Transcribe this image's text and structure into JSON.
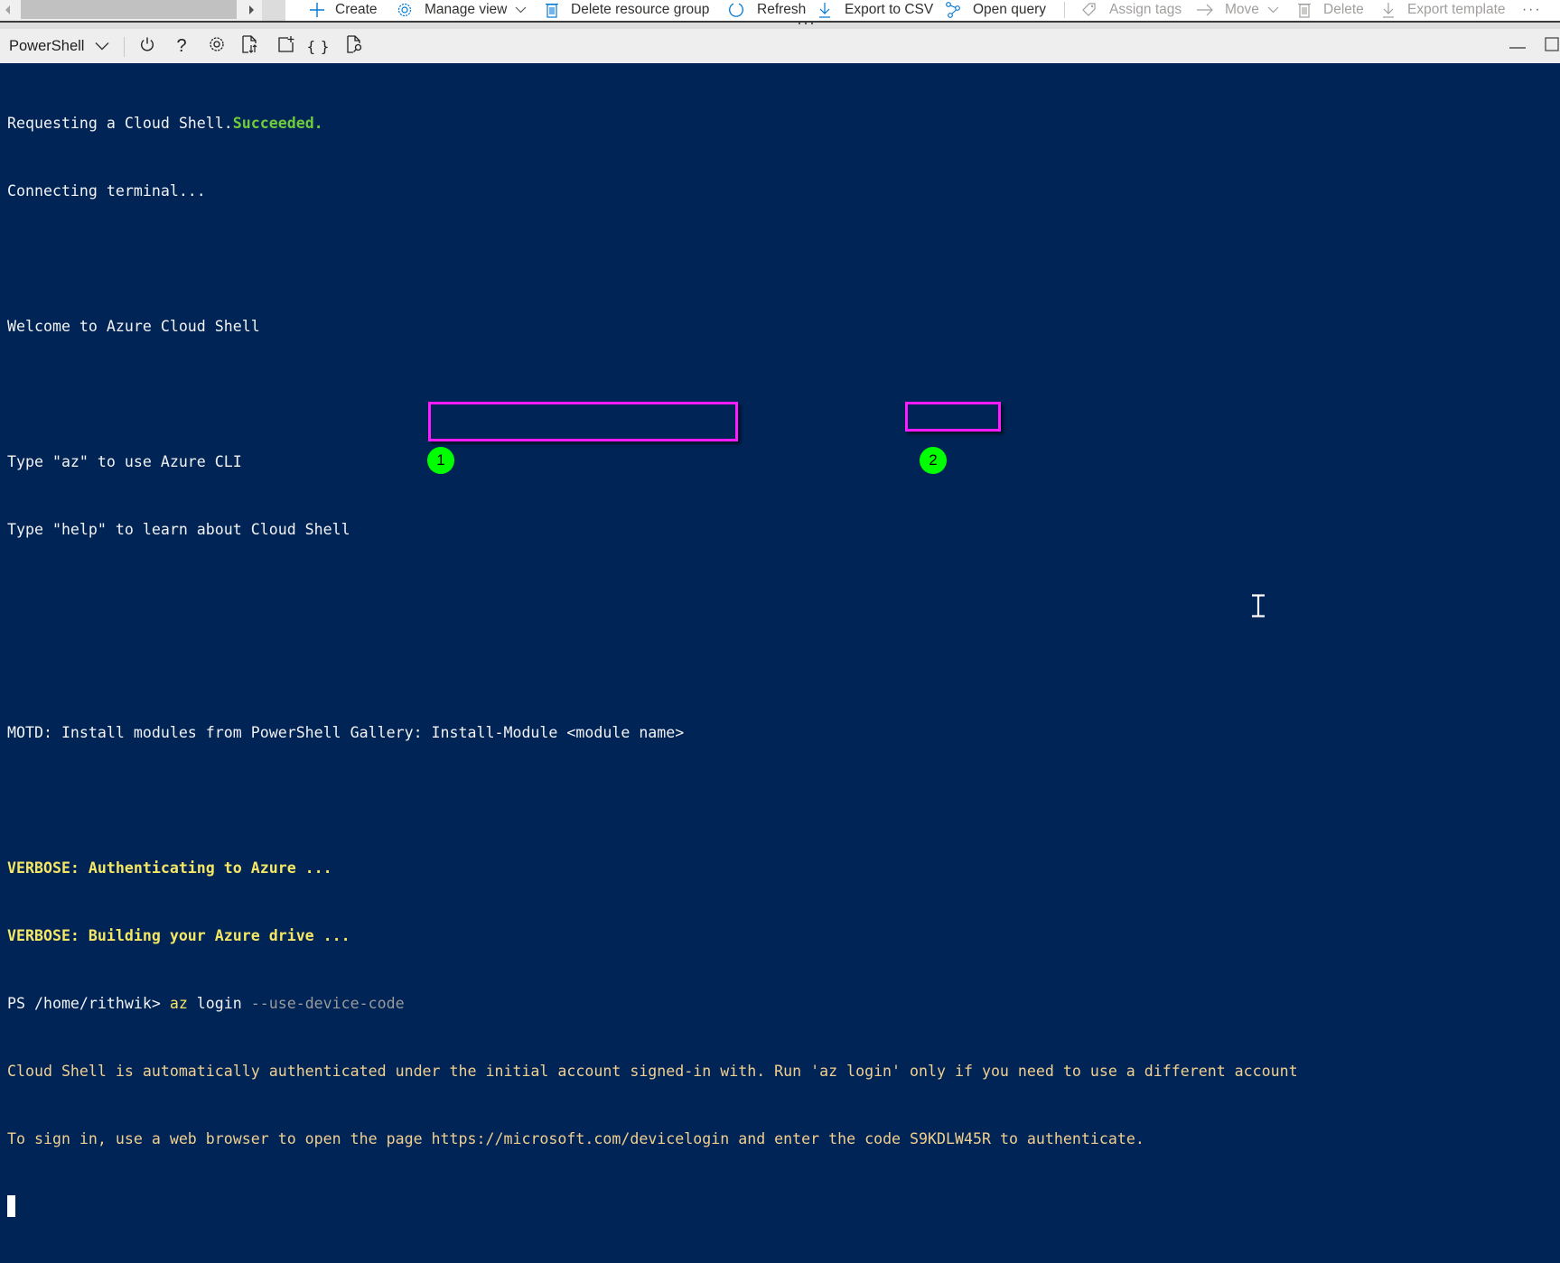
{
  "portal_commandbar": {
    "items": [
      {
        "label": "Create",
        "icon": "plus-icon",
        "enabled": true
      },
      {
        "label": "Manage view",
        "icon": "gear-icon",
        "enabled": true,
        "has_dropdown": true
      },
      {
        "label": "Delete resource group",
        "icon": "trash-icon",
        "enabled": true
      },
      {
        "label": "Refresh",
        "icon": "refresh-icon",
        "enabled": true
      },
      {
        "label": "Export to CSV",
        "icon": "download-icon",
        "enabled": true
      },
      {
        "label": "Open query",
        "icon": "query-icon",
        "enabled": true
      },
      {
        "label": "Assign tags",
        "icon": "tag-icon",
        "enabled": false
      },
      {
        "label": "Move",
        "icon": "arrow-right-icon",
        "enabled": false,
        "has_dropdown": true
      },
      {
        "label": "Delete",
        "icon": "trash-icon",
        "enabled": false
      },
      {
        "label": "Export template",
        "icon": "download-icon",
        "enabled": false
      }
    ],
    "more_label": "···"
  },
  "shell_toolbar": {
    "shell_type": "PowerShell",
    "buttons": [
      {
        "name": "restart",
        "icon": "power-icon"
      },
      {
        "name": "help",
        "icon": "help-icon",
        "glyph": "?"
      },
      {
        "name": "settings",
        "icon": "gear-icon"
      },
      {
        "name": "upload-download",
        "icon": "upload-download-file-icon"
      },
      {
        "name": "new-session",
        "icon": "new-session-icon"
      },
      {
        "name": "editor",
        "icon": "braces-icon",
        "glyph": "{ }"
      },
      {
        "name": "web-preview",
        "icon": "web-preview-icon"
      }
    ],
    "window_controls": [
      "minimize",
      "maximize"
    ]
  },
  "terminal": {
    "line1_prefix": "Requesting a Cloud Shell.",
    "line1_status": "Succeeded.",
    "line2": "Connecting terminal...",
    "welcome": "Welcome to Azure Cloud Shell",
    "tip_az": "Type \"az\" to use Azure CLI",
    "tip_help": "Type \"help\" to learn about Cloud Shell",
    "motd": "MOTD: Install modules from PowerShell Gallery: Install-Module <module name>",
    "verbose1": "VERBOSE: Authenticating to Azure ...",
    "verbose2": "VERBOSE: Building your Azure drive ...",
    "prompt": "PS /home/rithwik> ",
    "command": {
      "exe": "az",
      "sub": " login ",
      "args": "--use-device-code"
    },
    "notice": "Cloud Shell is automatically authenticated under the initial account signed-in with. Run 'az login' only if you need to use a different account",
    "signin_prefix": "To sign in, use a web browser to open the page ",
    "signin_url": "https://microsoft.com/devicelogin",
    "signin_middle": " and enter the code ",
    "signin_code": "S9KDLW45R",
    "signin_suffix": " to authenticate."
  },
  "annotations": [
    {
      "number": "1",
      "target": "signin_url",
      "color": "#ff1aff",
      "badge_color": "#00ff00"
    },
    {
      "number": "2",
      "target": "signin_code",
      "color": "#ff1aff",
      "badge_color": "#00ff00"
    }
  ],
  "colors": {
    "terminal_bg": "#012456",
    "success": "#6dcc3c",
    "verbose": "#f5e663",
    "warning_text": "#f0cf8f",
    "accent": "#0078d4"
  }
}
